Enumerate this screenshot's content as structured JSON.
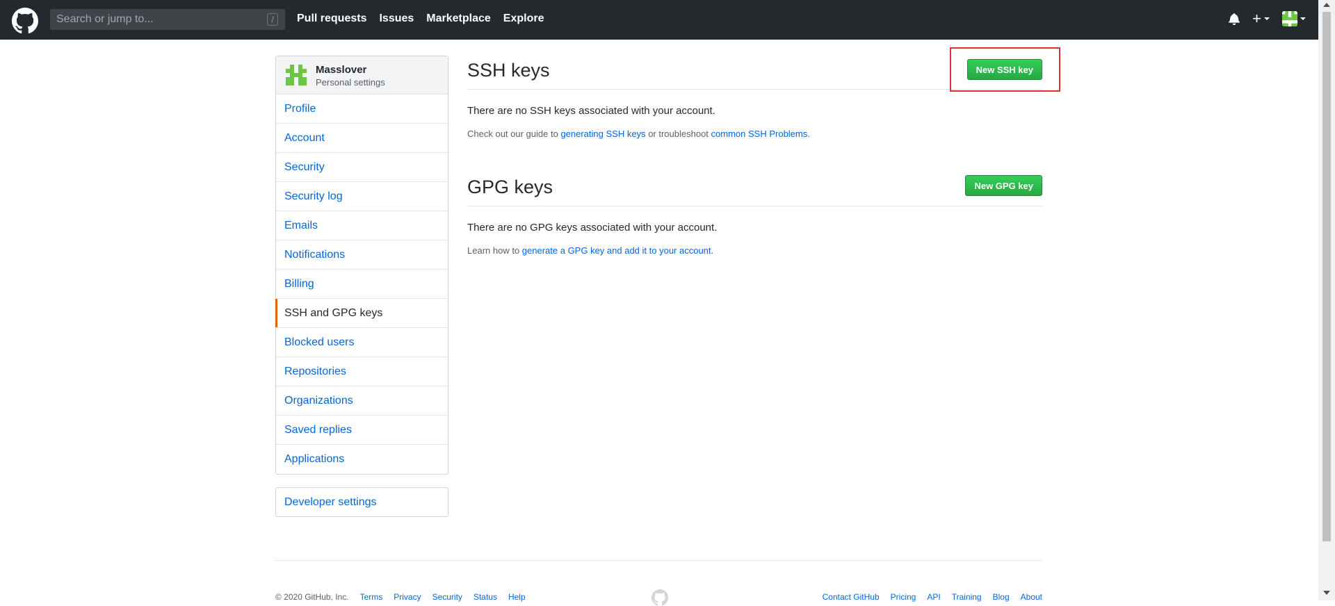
{
  "header": {
    "search_placeholder": "Search or jump to...",
    "search_shortcut": "/",
    "nav": [
      "Pull requests",
      "Issues",
      "Marketplace",
      "Explore"
    ],
    "plus_symbol": "+"
  },
  "sidebar": {
    "username": "Masslover",
    "subtitle": "Personal settings",
    "items": [
      "Profile",
      "Account",
      "Security",
      "Security log",
      "Emails",
      "Notifications",
      "Billing",
      "SSH and GPG keys",
      "Blocked users",
      "Repositories",
      "Organizations",
      "Saved replies",
      "Applications"
    ],
    "selected_index": 7,
    "developer_settings": "Developer settings"
  },
  "ssh": {
    "title": "SSH keys",
    "button": "New SSH key",
    "empty": "There are no SSH keys associated with your account.",
    "help_prefix": "Check out our guide to",
    "help_link1": "generating SSH keys",
    "help_middle": "or troubleshoot",
    "help_link2": "common SSH Problems",
    "help_suffix": "."
  },
  "gpg": {
    "title": "GPG keys",
    "button": "New GPG key",
    "empty": "There are no GPG keys associated with your account.",
    "help_prefix": "Learn how to",
    "help_link": "generate a GPG key and add it to your account",
    "help_suffix": "."
  },
  "footer": {
    "left": [
      "© 2020 GitHub, Inc.",
      "Terms",
      "Privacy",
      "Security",
      "Status",
      "Help"
    ],
    "right": [
      "Contact GitHub",
      "Pricing",
      "API",
      "Training",
      "Blog",
      "About"
    ]
  },
  "colors": {
    "header_bg": "#24292e",
    "link": "#0366d6",
    "green_button": "#28a745",
    "selected_accent": "#e36209",
    "highlight": "#e03131"
  }
}
